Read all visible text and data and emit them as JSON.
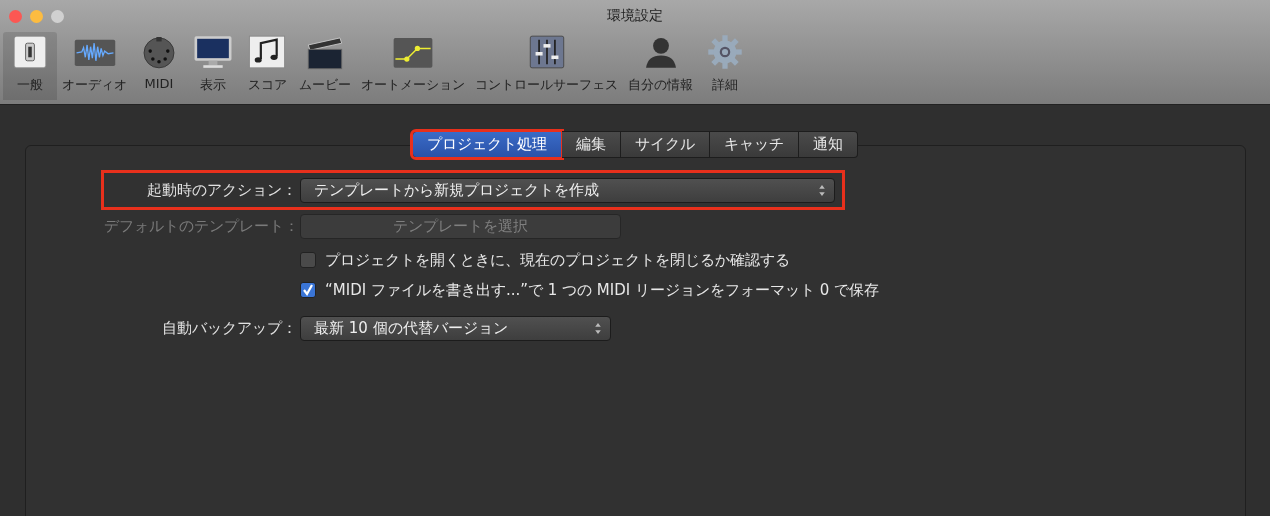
{
  "window": {
    "title": "環境設定"
  },
  "toolbar": [
    {
      "label": "一般",
      "kind": "switch",
      "selected": true
    },
    {
      "label": "オーディオ",
      "kind": "waveform",
      "selected": false
    },
    {
      "label": "MIDI",
      "kind": "midi",
      "selected": false
    },
    {
      "label": "表示",
      "kind": "display",
      "selected": false
    },
    {
      "label": "スコア",
      "kind": "score",
      "selected": false
    },
    {
      "label": "ムービー",
      "kind": "clapper",
      "selected": false
    },
    {
      "label": "オートメーション",
      "kind": "automation",
      "selected": false
    },
    {
      "label": "コントロールサーフェス",
      "kind": "mixer",
      "selected": false
    },
    {
      "label": "自分の情報",
      "kind": "person",
      "selected": false
    },
    {
      "label": "詳細",
      "kind": "gear",
      "selected": false
    }
  ],
  "tabs": [
    {
      "label": "プロジェクト処理",
      "selected": true,
      "highlighted": true
    },
    {
      "label": "編集",
      "selected": false,
      "highlighted": false
    },
    {
      "label": "サイクル",
      "selected": false,
      "highlighted": false
    },
    {
      "label": "キャッチ",
      "selected": false,
      "highlighted": false
    },
    {
      "label": "通知",
      "selected": false,
      "highlighted": false
    }
  ],
  "rows": [
    {
      "kind": "popup",
      "label": "起動時のアクション：",
      "value": "テンプレートから新規プロジェクトを作成",
      "disabled": false,
      "highlighted": true
    },
    {
      "kind": "button",
      "label": "デフォルトのテンプレート：",
      "value": "テンプレートを選択",
      "disabled": true,
      "highlighted": false
    },
    {
      "kind": "checkbox",
      "value": "プロジェクトを開くときに、現在のプロジェクトを閉じるか確認する",
      "checked": false
    },
    {
      "kind": "checkbox",
      "value": "“MIDI ファイルを書き出す...”で 1 つの MIDI リージョンをフォーマット 0 で保存",
      "checked": true
    },
    {
      "kind": "popup",
      "label": "自動バックアップ：",
      "value": "最新 10 個の代替バージョン",
      "disabled": false,
      "highlighted": false
    }
  ]
}
